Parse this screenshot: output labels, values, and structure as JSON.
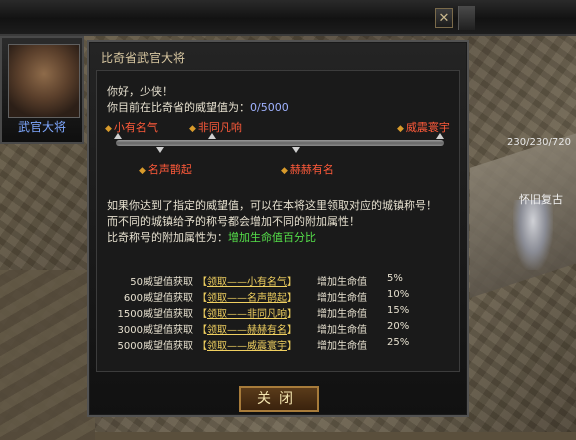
{
  "window": {
    "close_glyph": "✕"
  },
  "portrait": {
    "name": "武官大将",
    "icon": "general-portrait-icon"
  },
  "panel": {
    "title": "比奇省武官大将",
    "greeting": "你好，少侠！",
    "reputation_prefix": "你目前在比奇省的威望值为：",
    "reputation_value": "0/5000",
    "ranks_top": [
      "小有名气",
      "非同凡响",
      "威震寰宇"
    ],
    "ranks_bottom": [
      "名声鹊起",
      "赫赫有名"
    ],
    "description": [
      "如果你达到了指定的威望值，可以在本将这里领取对应的城镇称号！",
      "而不同的城镇给予的称号都会增加不同的附加属性！"
    ],
    "bonus_prefix": "比奇称号的附加属性为：",
    "bonus_value": "增加生命值百分比",
    "rewards": [
      {
        "req": "50威望值获取",
        "bracket_l": "【",
        "label": "领取——小有名气",
        "bracket_r": "】",
        "effect": "增加生命值",
        "pct": "5%"
      },
      {
        "req": "600威望值获取",
        "bracket_l": "【",
        "label": "领取——名声鹊起",
        "bracket_r": "】",
        "effect": "增加生命值",
        "pct": "10%"
      },
      {
        "req": "1500威望值获取",
        "bracket_l": "【",
        "label": "领取——非同凡响",
        "bracket_r": "】",
        "effect": "增加生命值",
        "pct": "15%"
      },
      {
        "req": "3000威望值获取",
        "bracket_l": "【",
        "label": "领取——赫赫有名",
        "bracket_r": "】",
        "effect": "增加生命值",
        "pct": "20%"
      },
      {
        "req": "5000威望值获取",
        "bracket_l": "【",
        "label": "领取——威震寰宇",
        "bracket_r": "】",
        "effect": "增加生命值",
        "pct": "25%"
      }
    ],
    "close_label": "关闭"
  },
  "overlay": {
    "hp_readout": "230/230/720",
    "npc_name": "怀旧复古"
  },
  "colors": {
    "rank_text": "#ff5a3a",
    "link_text": "#f0d060",
    "bonus_text": "#55e04a",
    "reputation_text": "#9fb2ff",
    "portrait_name": "#7fa8ff"
  }
}
